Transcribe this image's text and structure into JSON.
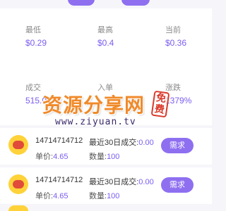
{
  "stats": {
    "low_label": "最低",
    "low_value": "$0.29",
    "high_label": "最高",
    "high_value": "$0.4",
    "current_label": "当前",
    "current_value": "$0.36",
    "volume_label": "成交",
    "volume_value": "515.0",
    "order_label": "入单",
    "order_value": "",
    "change_label": "涨跌",
    "change_value": "1379%"
  },
  "watermark": {
    "main": "资源分享网",
    "free": "免费",
    "url": "www.ziyuan.tv"
  },
  "rows": [
    {
      "phone": "14714714712",
      "deal_prefix": "最近30日成交:",
      "deal_value": "0.00",
      "price_prefix": "单价:",
      "price_value": "4.65",
      "qty_prefix": "数量:",
      "qty_value": "100",
      "button": "需求"
    },
    {
      "phone": "14714714712",
      "deal_prefix": "最近30日成交:",
      "deal_value": "0.00",
      "price_prefix": "单价:",
      "price_value": "4.65",
      "qty_prefix": "数量:",
      "qty_value": "100",
      "button": "需求"
    }
  ],
  "colors": {
    "accent": "#8e6ff0",
    "value_text": "#7b5cf0",
    "avatar": "#ffd23a"
  }
}
